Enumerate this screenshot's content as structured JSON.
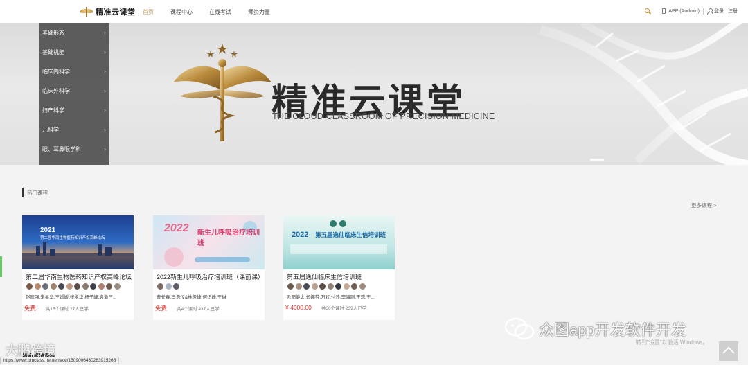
{
  "header": {
    "logo_text": "精准云课堂",
    "nav": [
      {
        "label": "首页",
        "active": true
      },
      {
        "label": "课程中心",
        "active": false
      },
      {
        "label": "在线考试",
        "active": false
      },
      {
        "label": "师资力量",
        "active": false
      }
    ],
    "app_label": "APP (Android)",
    "login_label": "登录",
    "register_label": "注册"
  },
  "banner": {
    "title": "精准云课堂",
    "subtitle": "THE CLOUD CLASSROOM OF PRECISION MEDICINE"
  },
  "categories": [
    {
      "label": "基础形态"
    },
    {
      "label": "基础机能"
    },
    {
      "label": "临床内科学"
    },
    {
      "label": "临床外科学"
    },
    {
      "label": "妇产科学"
    },
    {
      "label": "儿科学"
    },
    {
      "label": "眼、耳鼻喉学科"
    }
  ],
  "hot_courses": {
    "section_title": "热门课程",
    "more_label": "更多课程 >",
    "cards": [
      {
        "title": "第二届华南生物医药知识产权高峰论坛",
        "teachers": "赵建强,朱星华,王媛媛,张永华,杨子峰,袁激三...",
        "price": "免费",
        "meta": "共15个课时 27人已学",
        "image_caption": "第二届华南生物医药知识产权高峰论坛",
        "image_year": "2021"
      },
      {
        "title": "2022新生儿呼吸治疗培训班（课前课）",
        "teachers": "曹长春,冯浩仪&林俊捷,何炽峰,王琳",
        "price": "免费",
        "meta": "共4个课时 437人已学",
        "image_caption": "新生儿呼吸治疗培训班",
        "image_year": "2022"
      },
      {
        "title": "第五届逸仙临床生信培训班",
        "teachers": "欧阳能太,郑娜芬,万欢,付莎,李海刚,王莉,王...",
        "price": "¥ 4000.00",
        "meta": "共30个课时 239人已学",
        "image_caption": "第五届逸仙临床生信培训班",
        "image_year": "2022"
      }
    ]
  },
  "latest_title": "最新直播课程",
  "status_url": "https://www.pmclass.net/terrace/1509006430283915266",
  "watermark_left": "大鹏跨境",
  "watermark_right": "众图app开发软件开发",
  "activate_text": "转到\"设置\"以激活 Windows。",
  "colors": {
    "accent": "#c9a063",
    "price_red": "#e0312a",
    "sidebar_bg": "#505050"
  }
}
